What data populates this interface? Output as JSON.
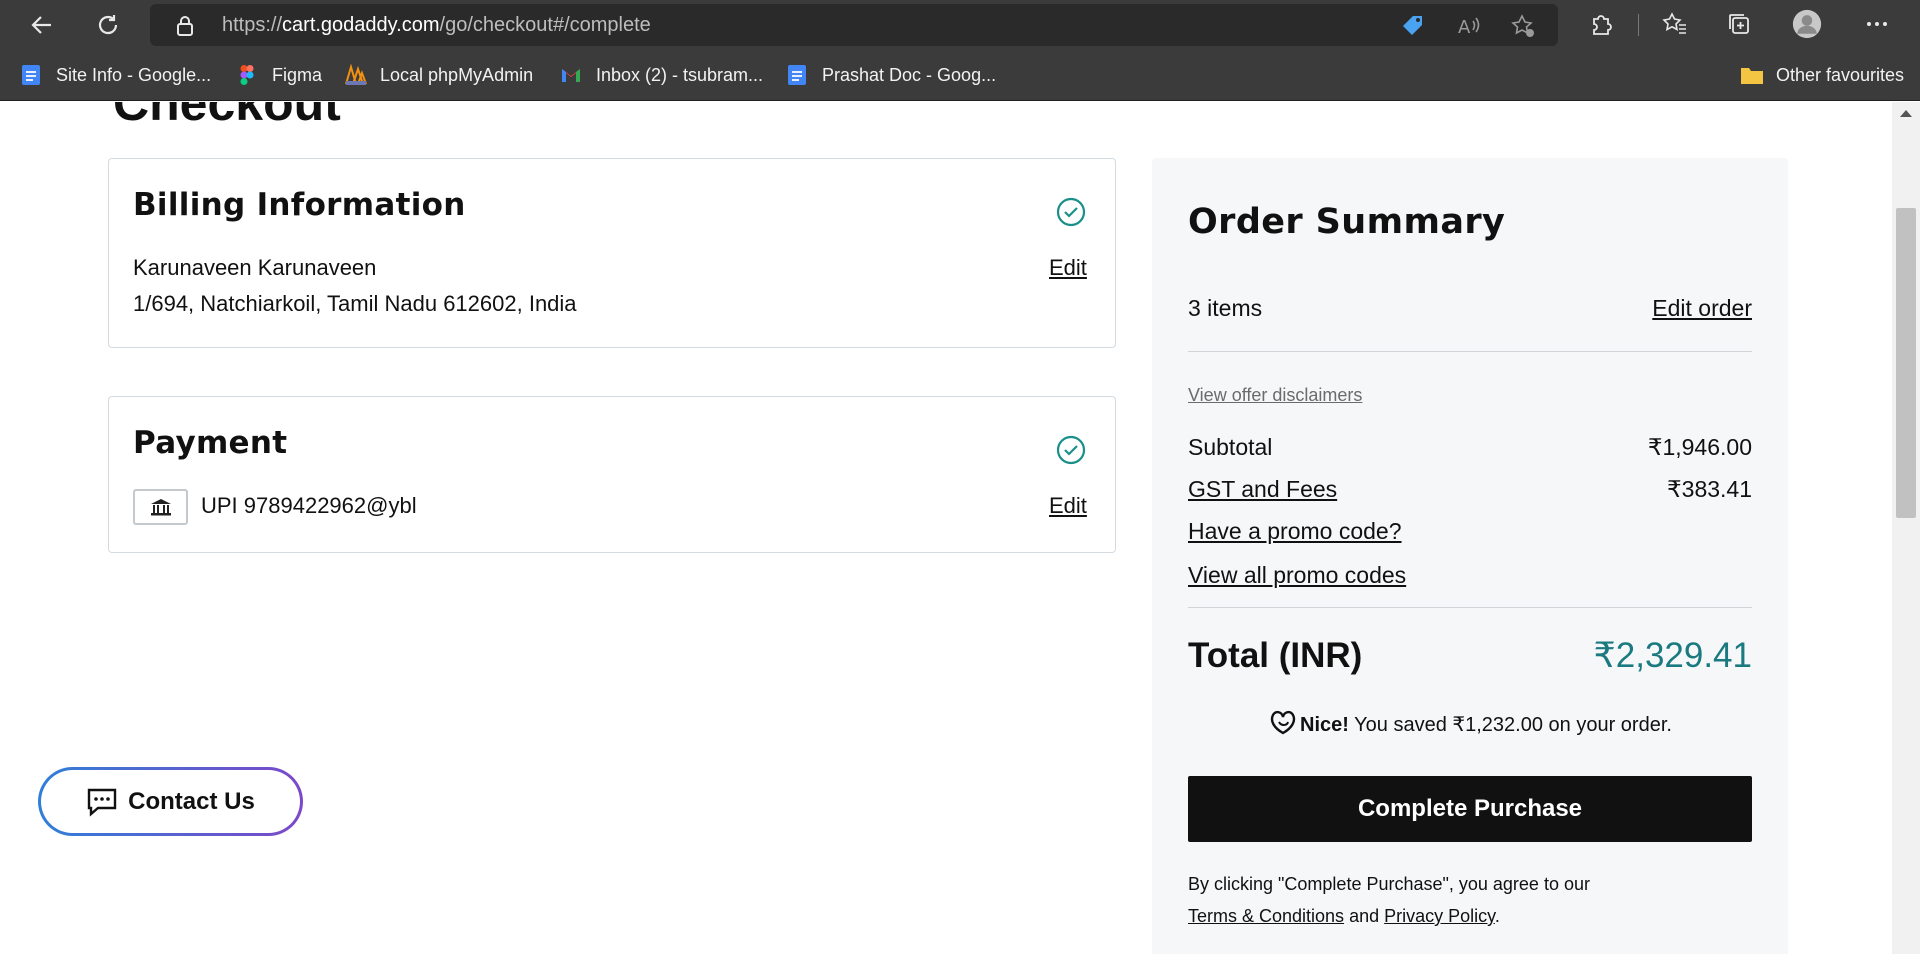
{
  "browser": {
    "url_prefix": "https://",
    "url_host": "cart.godaddy.com",
    "url_path": "/go/checkout#/complete"
  },
  "bookmarks": [
    {
      "label": "Site Info - Google...",
      "icon": "google-docs-icon",
      "color": "#4285f4"
    },
    {
      "label": "Figma",
      "icon": "figma-icon",
      "color": "#f24e1e"
    },
    {
      "label": "Local phpMyAdmin",
      "icon": "phpmyadmin-icon",
      "color": "#f29111"
    },
    {
      "label": "Inbox (2) - tsubram...",
      "icon": "gmail-icon",
      "color": "#ea4335"
    },
    {
      "label": "Prashat Doc - Goog...",
      "icon": "google-docs-icon",
      "color": "#4285f4"
    },
    {
      "label": "Other favourites",
      "icon": "folder-icon",
      "color": "#f4c542"
    }
  ],
  "page": {
    "title": "Checkout"
  },
  "billing": {
    "heading": "Billing Information",
    "name": "Karunaveen Karunaveen",
    "address": "1/694, Natchiarkoil, Tamil Nadu 612602, India",
    "edit_label": "Edit"
  },
  "payment": {
    "heading": "Payment",
    "method": "UPI 9789422962@ybl",
    "edit_label": "Edit"
  },
  "summary": {
    "heading": "Order Summary",
    "items_count": "3 items",
    "edit_order": "Edit order",
    "disclaimers": "View offer disclaimers",
    "subtotal_label": "Subtotal",
    "subtotal_value": "₹1,946.00",
    "gst_label": "GST and Fees",
    "gst_value": "₹383.41",
    "promo_label": "Have a promo code?",
    "view_promos": "View all promo codes",
    "total_label": "Total (INR)",
    "total_value": "₹2,329.41",
    "saved_bold": "Nice!",
    "saved_text": "You saved ₹1,232.00 on your order.",
    "button": "Complete Purchase",
    "legal_line1": "By clicking \"Complete Purchase\", you agree to our",
    "terms": "Terms & Conditions",
    "and": "and",
    "privacy": "Privacy Policy",
    "period": ".",
    "accent_color": "#1b7a80"
  },
  "contact": {
    "label": "Contact Us"
  }
}
